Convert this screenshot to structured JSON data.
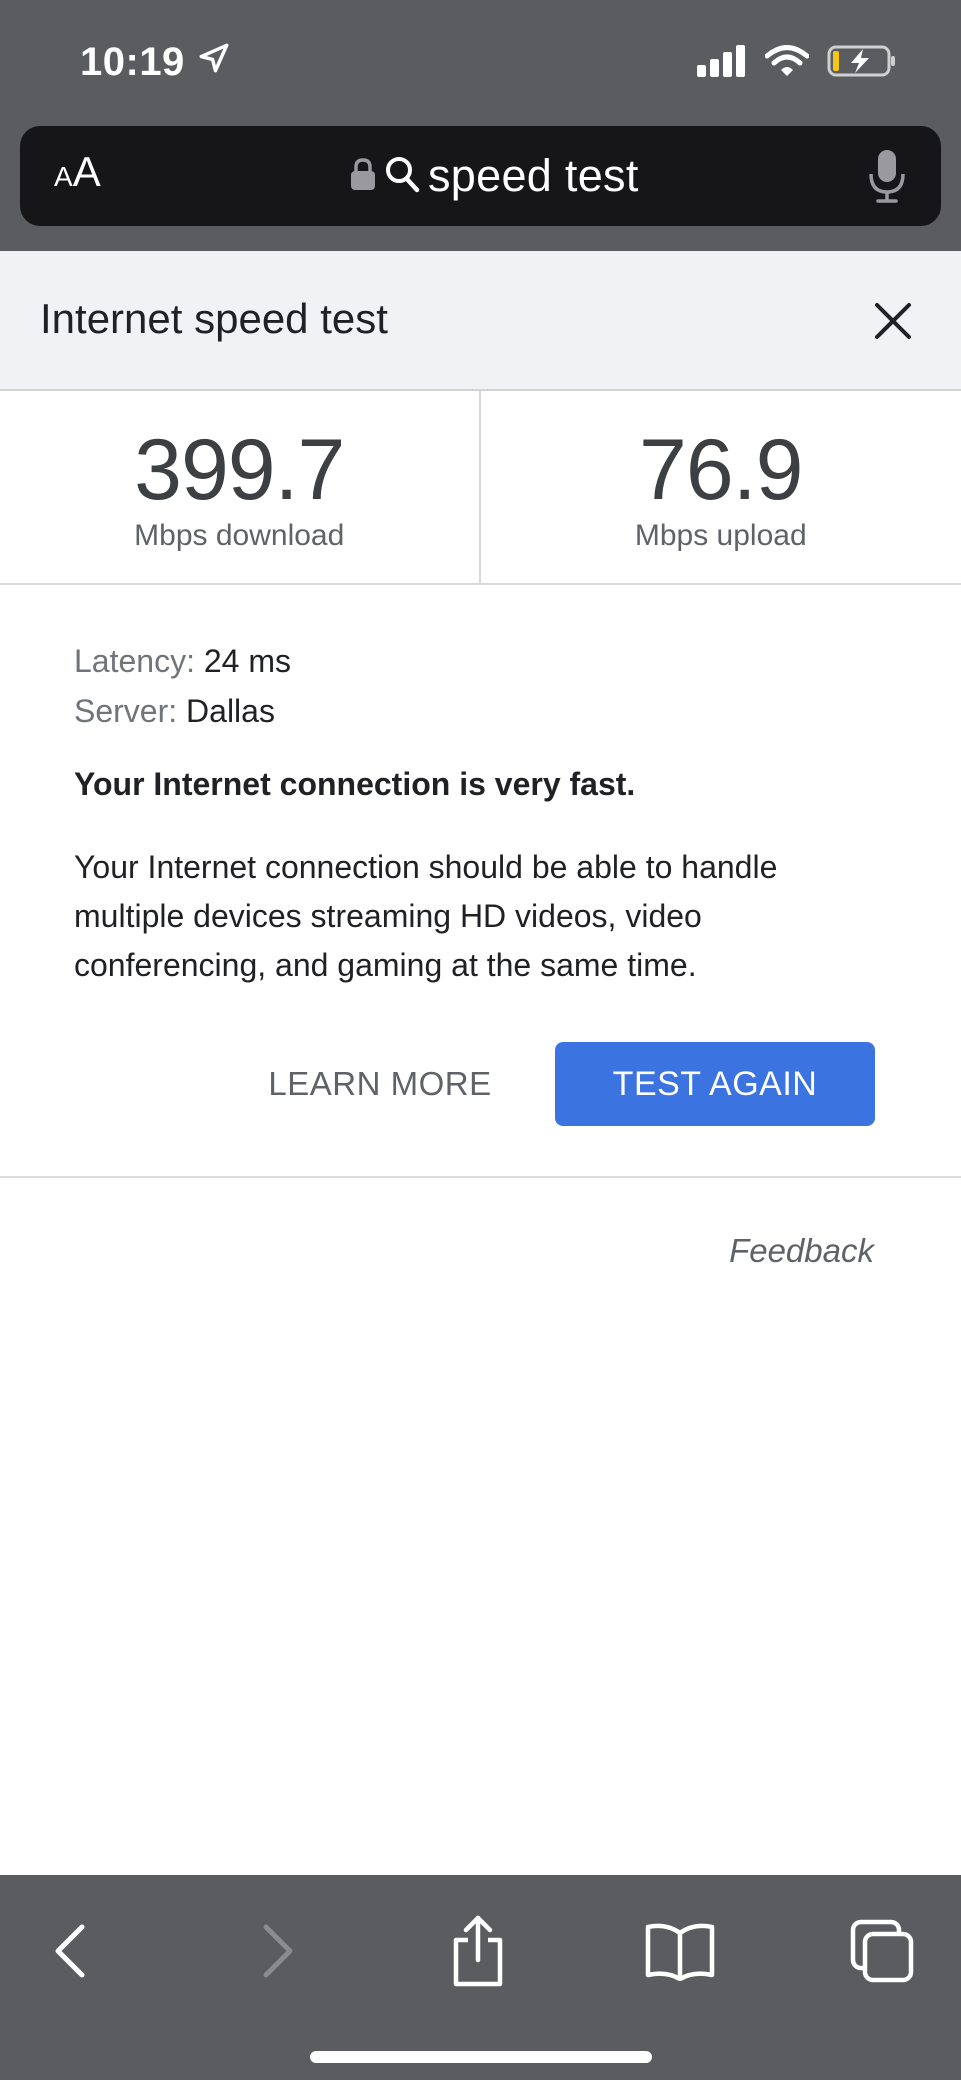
{
  "status_bar": {
    "time": "10:19"
  },
  "address_bar": {
    "aa_small": "A",
    "aa_big": "A",
    "query": "speed test"
  },
  "card": {
    "title": "Internet speed test",
    "download": {
      "value": "399.7",
      "label": "Mbps download"
    },
    "upload": {
      "value": "76.9",
      "label": "Mbps upload"
    },
    "latency": {
      "key": "Latency:",
      "value": "24 ms"
    },
    "server": {
      "key": "Server:",
      "value": "Dallas"
    },
    "verdict": "Your Internet connection is very fast.",
    "description": "Your Internet connection should be able to handle multiple devices streaming HD videos, video conferencing, and gaming at the same time.",
    "learn_more_label": "LEARN MORE",
    "test_again_label": "TEST AGAIN",
    "feedback_label": "Feedback"
  },
  "colors": {
    "chrome_bg": "#5b5c60",
    "url_bar_bg": "#161618",
    "primary_button": "#3b73e0",
    "battery_yellow": "#f5c518"
  },
  "icons": {
    "location": "location-arrow-icon",
    "signal": "cellular-signal-icon",
    "wifi": "wifi-icon",
    "battery": "battery-charging-icon",
    "lock": "lock-icon",
    "search": "search-icon",
    "mic": "microphone-icon",
    "close": "close-icon",
    "back": "chevron-left-icon",
    "forward": "chevron-right-icon",
    "share": "share-icon",
    "bookmarks": "book-icon",
    "tabs": "tabs-icon"
  }
}
